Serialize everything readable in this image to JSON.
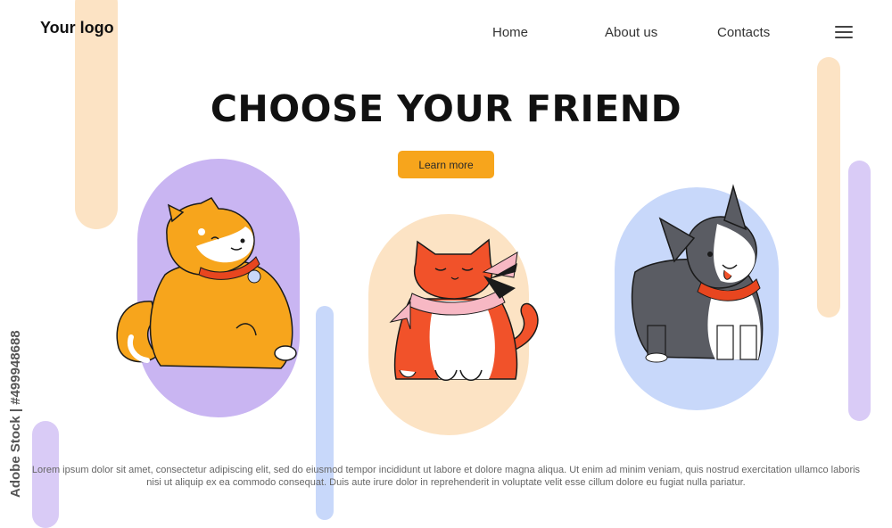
{
  "header": {
    "logo": "Your logo",
    "nav": [
      {
        "label": "Home"
      },
      {
        "label": "About us"
      },
      {
        "label": "Contacts"
      }
    ],
    "menu_icon": "hamburger-menu-icon"
  },
  "hero": {
    "title": "CHOOSE YOUR FRIEND",
    "cta_label": "Learn more"
  },
  "pets": [
    {
      "name": "shiba-inu",
      "frame_color": "#c9b5f2",
      "body_color": "#f7a51c"
    },
    {
      "name": "red-cat",
      "frame_color": "#fce3c4",
      "body_color": "#f1522a"
    },
    {
      "name": "boston-terrier",
      "frame_color": "#c8d8fa",
      "body_color": "#5a5c63"
    }
  ],
  "footer": {
    "text": "Lorem ipsum dolor sit amet, consectetur adipiscing elit, sed do eiusmod tempor incididunt ut labore et dolore magna aliqua. Ut enim ad minim veniam, quis nostrud exercitation ullamco laboris nisi ut aliquip ex ea commodo consequat. Duis aute irure dolor in reprehenderit in voluptate velit esse cillum dolore eu fugiat nulla pariatur."
  },
  "watermark": "Adobe Stock | #499948688",
  "colors": {
    "accent": "#f7a51c",
    "peach": "#fce3c4",
    "lavender": "#c9b5f2",
    "blue": "#c8d8fa"
  }
}
